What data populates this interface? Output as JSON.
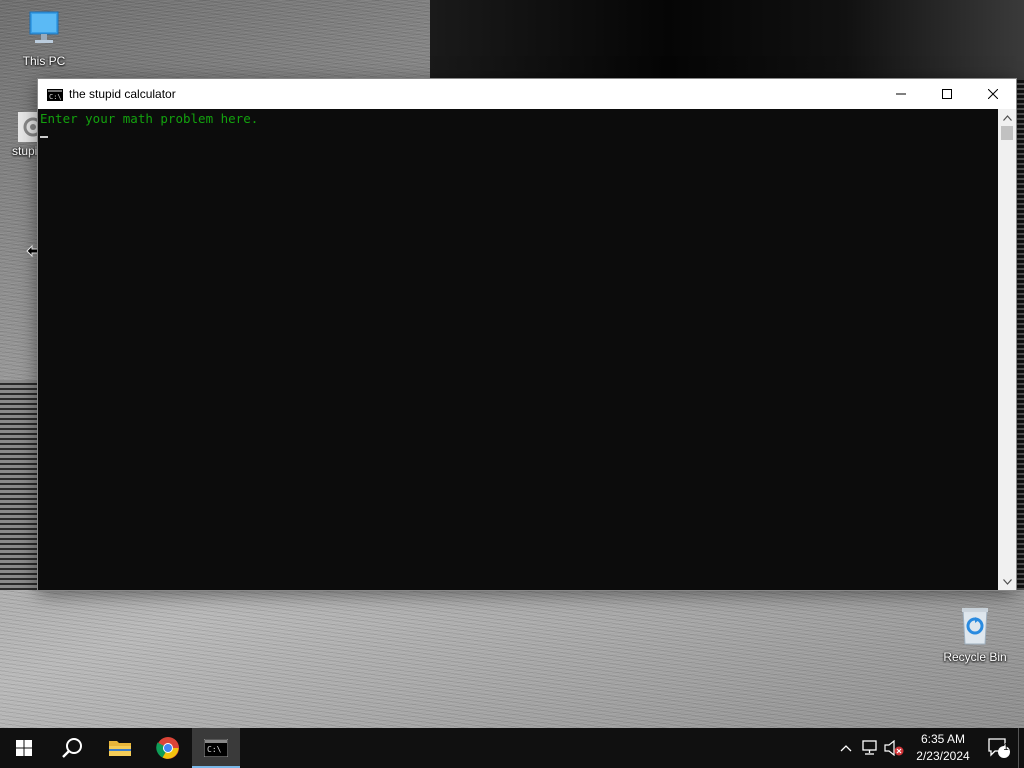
{
  "desktop": {
    "icons": [
      {
        "label": "This PC",
        "icon": "this-pc-icon"
      },
      {
        "label": "stupi",
        "icon": "gear-icon"
      },
      {
        "label": "Recycle Bin",
        "icon": "recycle-bin-icon"
      }
    ]
  },
  "window": {
    "title": "the stupid calculator",
    "app_icon": "console-icon",
    "controls": {
      "minimize": "minimize-icon",
      "maximize": "maximize-icon",
      "close": "close-icon"
    }
  },
  "console": {
    "prompt": "Enter your math problem here.",
    "text_color": "#13a10e",
    "background": "#0c0c0c"
  },
  "taskbar": {
    "apps": [
      {
        "name": "start",
        "icon": "windows-start-icon"
      },
      {
        "name": "search",
        "icon": "search-icon"
      },
      {
        "name": "file-explorer",
        "icon": "folder-icon"
      },
      {
        "name": "chrome",
        "icon": "chrome-icon"
      },
      {
        "name": "console",
        "icon": "console-icon",
        "active": true
      }
    ],
    "tray": {
      "icons": [
        "chevron-up-icon",
        "network-icon",
        "volume-muted-icon"
      ],
      "time": "6:35 AM",
      "date": "2/23/2024",
      "notification_count": "1"
    }
  }
}
